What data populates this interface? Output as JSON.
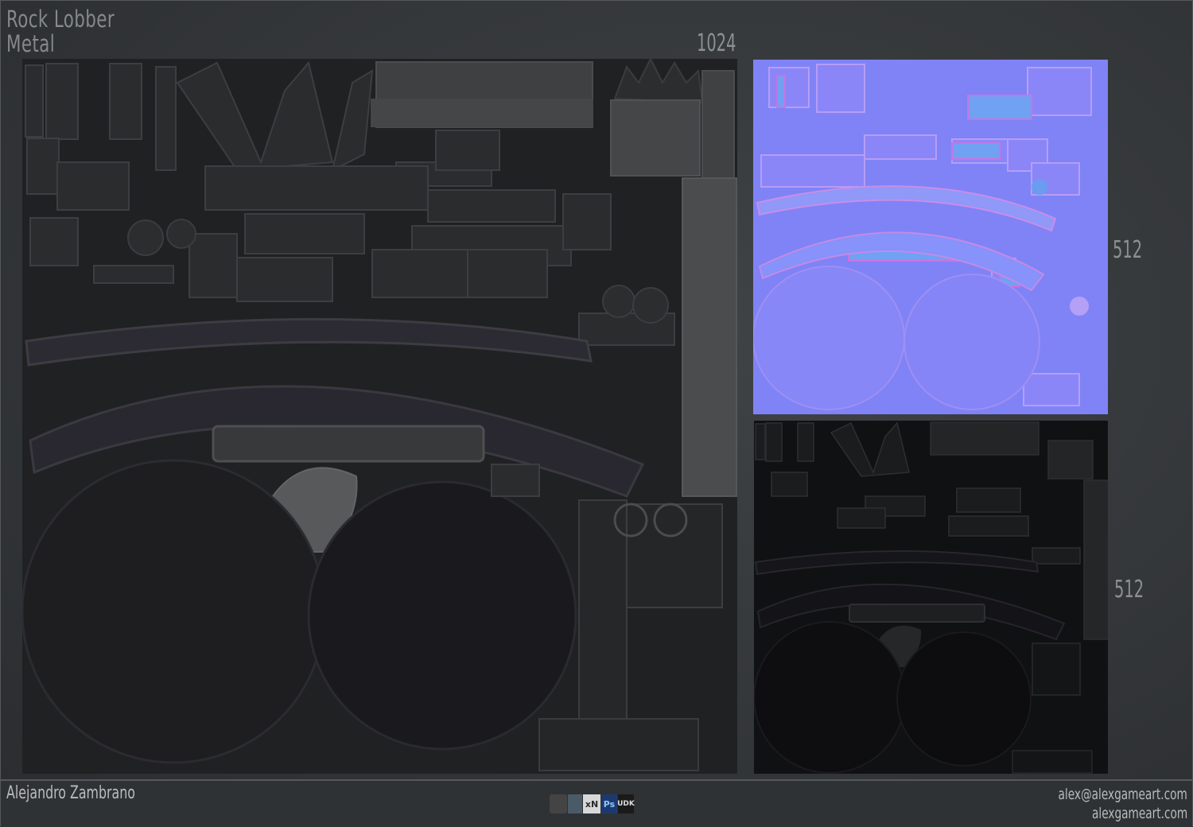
{
  "header": {
    "title_line1": "Rock Lobber",
    "title_line2": "Metal"
  },
  "maps": {
    "diffuse_size": "1024",
    "normal_size": "512",
    "specular_size": "512"
  },
  "footer": {
    "author": "Alejandro Zambrano",
    "email": "alex@alexgameart.com",
    "website": "alexgameart.com",
    "tool_logos": [
      {
        "icon": "zbrush-logo-icon",
        "label": ""
      },
      {
        "icon": "3ds-max-logo-icon",
        "label": ""
      },
      {
        "icon": "xnormal-logo-icon",
        "label": "xN"
      },
      {
        "icon": "photoshop-logo-icon",
        "label": "Ps"
      },
      {
        "icon": "udk-logo-icon",
        "label": "UDK"
      }
    ]
  },
  "colors": {
    "background": "#34373a",
    "diffuse_base": "#202223",
    "normal_base": "#7f83f5",
    "specular_base": "#111213"
  }
}
